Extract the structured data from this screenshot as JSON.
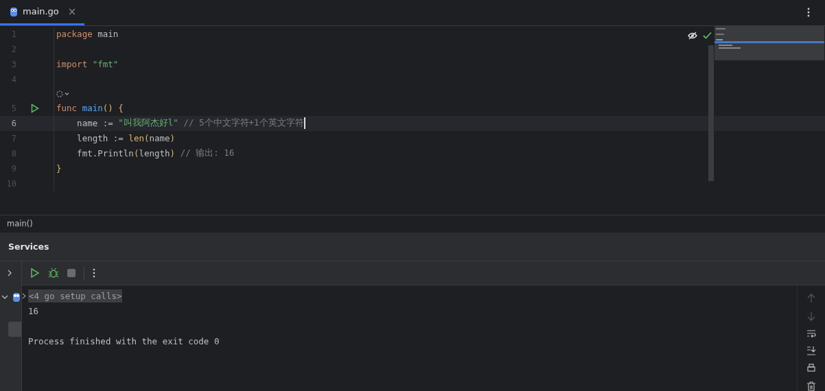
{
  "tabs": [
    {
      "label": "main.go",
      "selected": true,
      "close": "×"
    }
  ],
  "editor": {
    "lines": [
      {
        "kind": "code",
        "number": "1",
        "current": false,
        "run_marker": false,
        "tokens": [
          {
            "text": "package ",
            "kind": "keyword"
          },
          {
            "text": "main",
            "kind": "plain"
          }
        ]
      },
      {
        "kind": "code",
        "number": "2",
        "current": false,
        "run_marker": false
      },
      {
        "kind": "code",
        "number": "3",
        "current": false,
        "run_marker": false,
        "tokens": [
          {
            "text": "import ",
            "kind": "keyword"
          },
          {
            "text": "\"fmt\"",
            "kind": "string"
          }
        ]
      },
      {
        "kind": "code",
        "number": "4",
        "current": false,
        "run_marker": false
      },
      {
        "kind": "hint"
      },
      {
        "kind": "code",
        "number": "5",
        "current": false,
        "run_marker": true,
        "tokens": [
          {
            "text": "func ",
            "kind": "keyword"
          },
          {
            "text": "main",
            "kind": "function"
          },
          {
            "text": "() {",
            "kind": "paren"
          }
        ]
      },
      {
        "kind": "code",
        "number": "6",
        "current": true,
        "run_marker": false,
        "tokens": [
          {
            "text": "    name := ",
            "kind": "plain"
          },
          {
            "text": "\"叫我阿杰好l\"",
            "kind": "string"
          },
          {
            "text": " // 5个中文字符+1个英文字符",
            "kind": "comment"
          }
        ]
      },
      {
        "kind": "code",
        "number": "7",
        "current": false,
        "run_marker": false,
        "tokens": [
          {
            "text": "    length := ",
            "kind": "plain"
          },
          {
            "text": "len",
            "kind": "builtin"
          },
          {
            "text": "(",
            "kind": "paren"
          },
          {
            "text": "name",
            "kind": "plain"
          },
          {
            "text": ")",
            "kind": "paren"
          }
        ]
      },
      {
        "kind": "code",
        "number": "8",
        "current": false,
        "run_marker": false,
        "tokens": [
          {
            "text": "    fmt.",
            "kind": "plain"
          },
          {
            "text": "Println",
            "kind": "call"
          },
          {
            "text": "(",
            "kind": "paren"
          },
          {
            "text": "length",
            "kind": "plain"
          },
          {
            "text": ")",
            "kind": "paren"
          },
          {
            "text": " // 输出: 16",
            "kind": "comment"
          }
        ]
      },
      {
        "kind": "code",
        "number": "9",
        "current": false,
        "run_marker": false,
        "tokens": [
          {
            "text": "}",
            "kind": "paren"
          }
        ]
      },
      {
        "kind": "code",
        "number": "10",
        "current": false,
        "run_marker": false
      }
    ]
  },
  "breadcrumb": "main()",
  "services": {
    "title": "Services",
    "console": [
      {
        "kind": "folded",
        "text": "<4 go setup calls>"
      },
      {
        "kind": "output",
        "text": "16"
      },
      {
        "kind": "exit",
        "text": "Process finished with the exit code 0"
      }
    ]
  }
}
